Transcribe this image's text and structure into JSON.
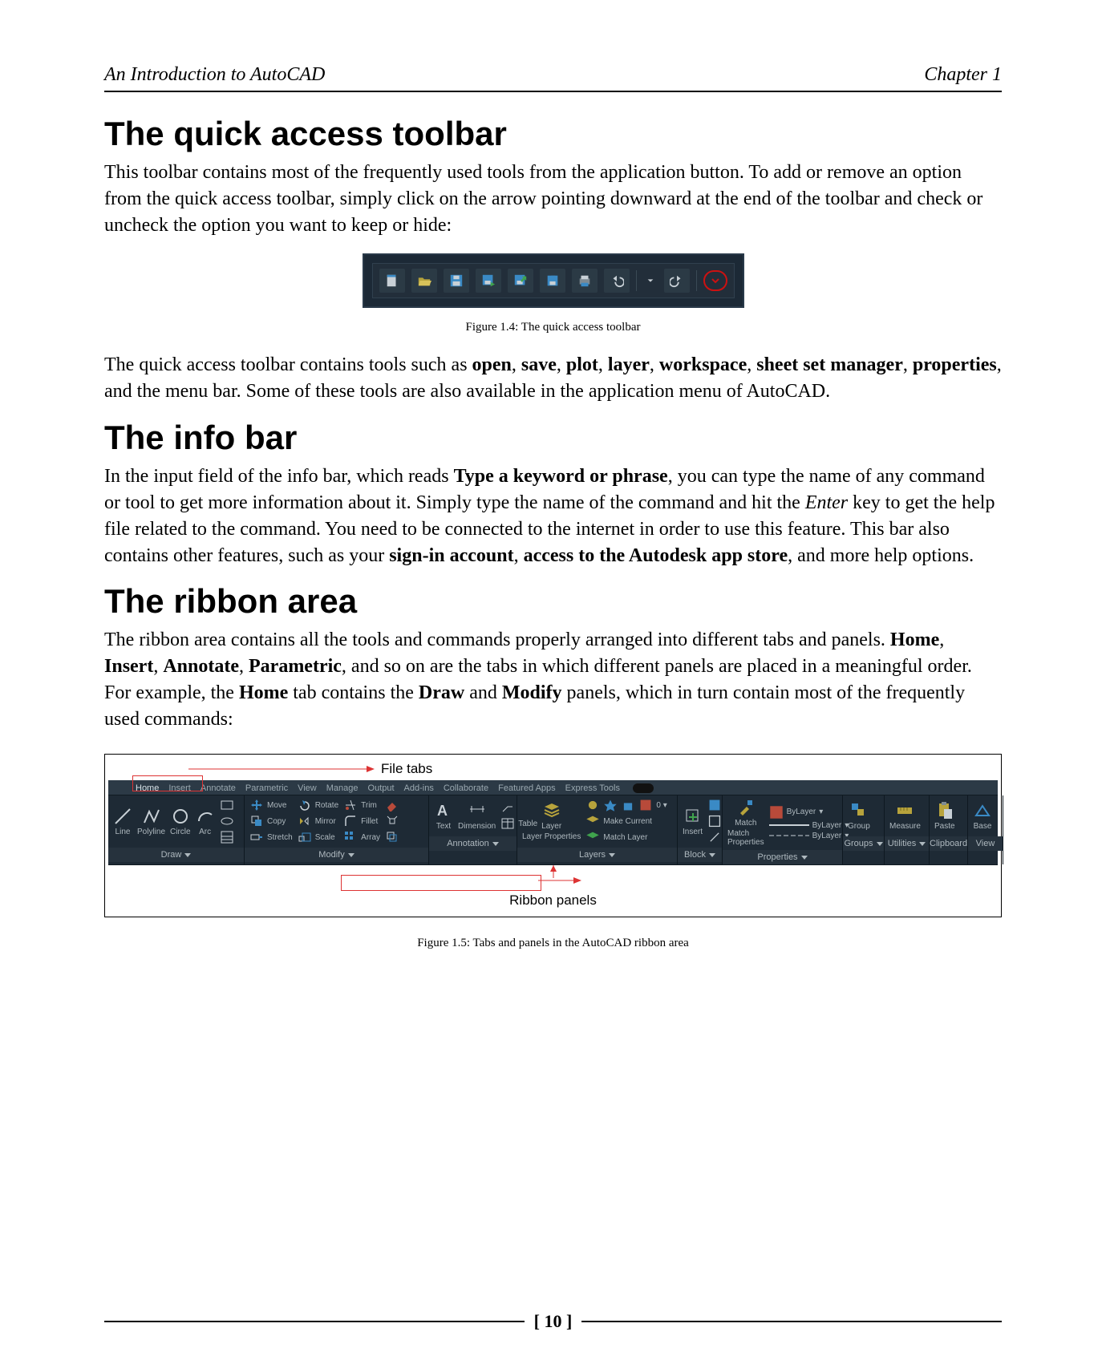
{
  "header": {
    "book": "An Introduction to AutoCAD",
    "chapter": "Chapter 1"
  },
  "section1": {
    "title": "The quick access toolbar",
    "para1": "This toolbar contains most of the frequently used tools from the application button. To add or remove an option from the quick access toolbar, simply click on the arrow pointing downward at the end of the toolbar and check or uncheck the option you want to keep or hide:",
    "caption": "Figure 1.4: The quick access toolbar",
    "para2a": "The quick access toolbar contains tools such as ",
    "b1": "open",
    "c1": ", ",
    "b2": "save",
    "c2": ", ",
    "b3": "plot",
    "c3": ", ",
    "b4": "layer",
    "c4": ", ",
    "b5": "workspace",
    "c5": ", ",
    "b6": "sheet set manager",
    "c6": ", ",
    "b7": "properties",
    "para2b": ", and the menu bar. Some of these tools are also available in the application menu of AutoCAD."
  },
  "section2": {
    "title": "The info bar",
    "pre": "In the input field of the info bar, which reads ",
    "b1": "Type a keyword or phrase",
    "mid1": ", you can type the name of any command or tool to get more information about it. Simply type the name of the command and hit the ",
    "em1": "Enter",
    "mid2": " key to get the help file related to the command. You need to be connected to the internet in order to use this feature. This bar also contains other features, such as your ",
    "b2": "sign-in account",
    "c1": ", ",
    "b3": "access to the Autodesk app store",
    "post": ", and more help options."
  },
  "section3": {
    "title": "The ribbon area",
    "pre": "The ribbon area contains all the tools and commands properly arranged into different tabs and panels. ",
    "b1": "Home",
    "c1": ", ",
    "b2": "Insert",
    "c2": ", ",
    "b3": "Annotate",
    "c3": ", ",
    "b4": "Parametric",
    "mid": ", and so on are the tabs in which different panels are placed in a meaningful order. For example, the ",
    "b5": "Home",
    "mid2": " tab contains the ",
    "b6": "Draw",
    "c4": " and ",
    "b7": "Modify",
    "post": " panels, which in turn contain most of the frequently used commands:",
    "fileTabsLabel": "File tabs",
    "ribbonPanelsLabel": "Ribbon panels",
    "caption": "Figure 1.5: Tabs and panels in the AutoCAD ribbon area"
  },
  "ribbon": {
    "tabs": [
      "Home",
      "Insert",
      "Annotate",
      "Parametric",
      "View",
      "Manage",
      "Output",
      "Add-ins",
      "Collaborate",
      "Featured Apps",
      "Express Tools"
    ],
    "draw": {
      "line": "Line",
      "polyline": "Polyline",
      "circle": "Circle",
      "arc": "Arc",
      "name": "Draw"
    },
    "modify": {
      "move": "Move",
      "copy": "Copy",
      "stretch": "Stretch",
      "rotate": "Rotate",
      "mirror": "Mirror",
      "scale": "Scale",
      "trim": "Trim",
      "fillet": "Fillet",
      "array": "Array",
      "name": "Modify"
    },
    "annotation": {
      "text": "Text",
      "dim": "Dimension",
      "table": "Table",
      "name": "Annotation"
    },
    "layers": {
      "props": "Layer Properties",
      "makecurrent": "Make Current",
      "matchlayer": "Match Layer",
      "name": "Layers"
    },
    "block": {
      "insert": "Insert",
      "name": "Block"
    },
    "properties": {
      "match": "Match Properties",
      "byl": "ByLayer",
      "name": "Properties"
    },
    "groups": {
      "group": "Group",
      "name": "Groups"
    },
    "utilities": {
      "measure": "Measure",
      "name": "Utilities"
    },
    "clipboard": {
      "paste": "Paste",
      "name": "Clipboard"
    },
    "view": {
      "base": "Base",
      "name": "View"
    }
  },
  "pageNumber": "[ 10 ]"
}
